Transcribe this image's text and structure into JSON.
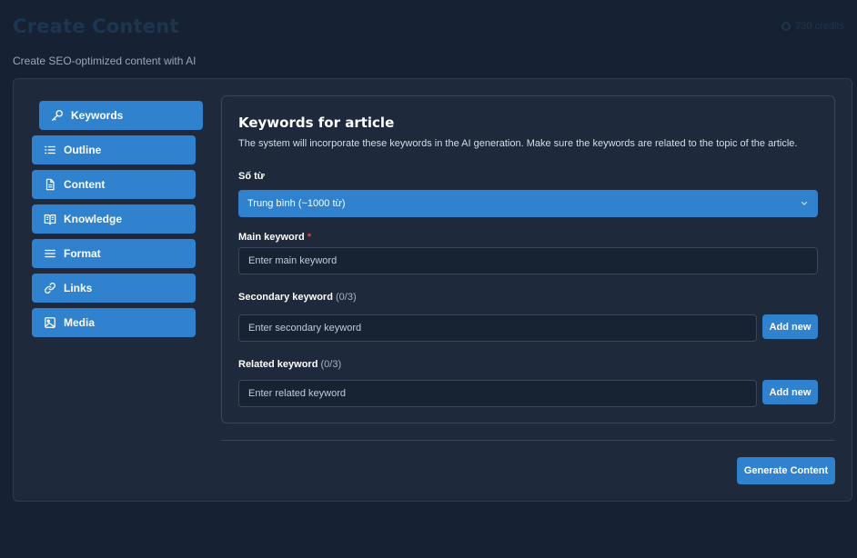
{
  "header": {
    "title": "Create Content",
    "credits": "730 credits",
    "subtitle": "Create SEO-optimized content with AI"
  },
  "sidebar": {
    "items": [
      {
        "label": "Keywords",
        "icon": "key-icon",
        "active": true
      },
      {
        "label": "Outline",
        "icon": "list-icon"
      },
      {
        "label": "Content",
        "icon": "document-icon"
      },
      {
        "label": "Knowledge",
        "icon": "book-icon"
      },
      {
        "label": "Format",
        "icon": "lines-icon"
      },
      {
        "label": "Links",
        "icon": "link-icon"
      },
      {
        "label": "Media",
        "icon": "image-icon"
      }
    ]
  },
  "panel": {
    "title": "Keywords for article",
    "description": "The system will incorporate these keywords in the AI generation. Make sure the keywords are related to the topic of the article.",
    "word_count_label": "Số từ",
    "word_count_value": "Trung bình (~1000 từ)",
    "main_keyword_label": "Main keyword",
    "main_keyword_required": "*",
    "main_keyword_placeholder": "Enter main keyword",
    "secondary_label": "Secondary keyword",
    "secondary_count": "(0/3)",
    "secondary_placeholder": "Enter secondary keyword",
    "related_label": "Related keyword",
    "related_count": "(0/3)",
    "related_placeholder": "Enter related keyword",
    "add_new_label": "Add new"
  },
  "footer": {
    "generate_label": "Generate Content"
  },
  "colors": {
    "accent": "#3182ce",
    "background": "#162234",
    "card": "#1e293b",
    "required": "#e53e3e"
  }
}
